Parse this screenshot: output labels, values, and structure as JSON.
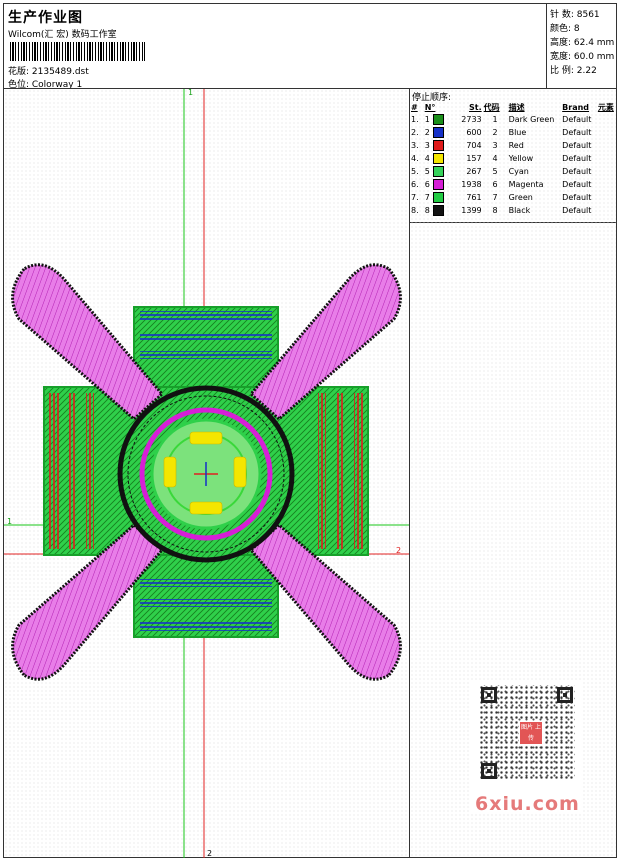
{
  "header": {
    "title": "生产作业图",
    "subtitle": "Wilcom(汇 宏) 数码工作室",
    "design_label": "花版: 2135489.dst",
    "colorway_label": "色位: Colorway 1"
  },
  "stats": {
    "stitches": "针 数: 8561",
    "colors": "颜色: 8",
    "height": "高度: 62.4 mm",
    "width": "宽度: 60.0 mm",
    "scale": "比 例: 2.22"
  },
  "guides": {
    "v1": "1",
    "v2": "2",
    "h1": "1",
    "h2": "2"
  },
  "stop_sequence": {
    "title": "停止顺序:",
    "headers": [
      "#",
      "N°",
      "St.",
      "代码",
      "描述",
      "Brand",
      "元素"
    ],
    "rows": [
      {
        "idx": "1.",
        "n": "1",
        "color": "#1a8f1a",
        "st": "2733",
        "code": "1",
        "desc": "Dark Green",
        "brand": "Default"
      },
      {
        "idx": "2.",
        "n": "2",
        "color": "#1530c8",
        "st": "600",
        "code": "2",
        "desc": "Blue",
        "brand": "Default"
      },
      {
        "idx": "3.",
        "n": "3",
        "color": "#e01b1b",
        "st": "704",
        "code": "3",
        "desc": "Red",
        "brand": "Default"
      },
      {
        "idx": "4.",
        "n": "4",
        "color": "#f4e600",
        "st": "157",
        "code": "4",
        "desc": "Yellow",
        "brand": "Default"
      },
      {
        "idx": "5.",
        "n": "5",
        "color": "#35d35a",
        "st": "267",
        "code": "5",
        "desc": "Cyan",
        "brand": "Default"
      },
      {
        "idx": "6.",
        "n": "6",
        "color": "#d61fd6",
        "st": "1938",
        "code": "6",
        "desc": "Magenta",
        "brand": "Default"
      },
      {
        "idx": "7.",
        "n": "7",
        "color": "#22cc44",
        "st": "761",
        "code": "7",
        "desc": "Green",
        "brand": "Default"
      },
      {
        "idx": "8.",
        "n": "8",
        "color": "#111111",
        "st": "1399",
        "code": "8",
        "desc": "Black",
        "brand": "Default"
      }
    ]
  },
  "qr": {
    "logo_text": "图片 上传"
  },
  "watermark": "6xiu.com"
}
